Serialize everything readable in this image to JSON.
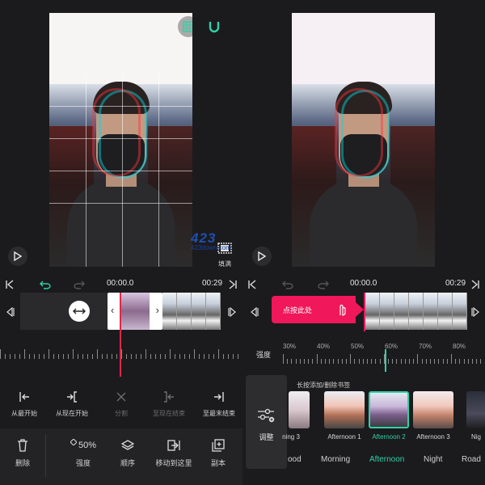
{
  "left": {
    "fill_label": "填满",
    "transport": {
      "current_time": "00:00.0",
      "end_time": "00:29"
    },
    "tools": [
      {
        "label": "从最开始",
        "dim": false
      },
      {
        "label": "从现在开始",
        "dim": false
      },
      {
        "label": "分割",
        "dim": true
      },
      {
        "label": "至现在结束",
        "dim": true
      },
      {
        "label": "至最末结束",
        "dim": false
      }
    ],
    "bottom": {
      "delete": "删除",
      "strength_value": "50%",
      "strength": "强度",
      "order": "顺序",
      "move_here": "移动到这里",
      "copy": "副本"
    }
  },
  "watermark": {
    "big": "423",
    "small": "423down.com"
  },
  "right": {
    "transport": {
      "current_time": "00:00.0",
      "end_time": "00:29"
    },
    "tap_button": "点按此处",
    "strength_label": "强度",
    "ruler_percents": [
      "30%",
      "40%",
      "50%",
      "60%",
      "70%",
      "80%"
    ],
    "strength_value_pct": 60,
    "adjust_label": "调整",
    "hint": "长按添加/删除书签",
    "filters": [
      {
        "name": "ning 3",
        "active": false
      },
      {
        "name": "Afternoon 1",
        "active": false
      },
      {
        "name": "Afternoon 2",
        "active": true
      },
      {
        "name": "Afternoon 3",
        "active": false
      },
      {
        "name": "Nig",
        "active": false
      }
    ],
    "categories": [
      {
        "name": "ood",
        "active": false
      },
      {
        "name": "Morning",
        "active": false
      },
      {
        "name": "Afternoon",
        "active": true
      },
      {
        "name": "Night",
        "active": false
      },
      {
        "name": "Road",
        "active": false
      }
    ]
  },
  "colors": {
    "accent": "#2fd1a8",
    "red": "#f0175a",
    "bg": "#1b1b1d"
  }
}
